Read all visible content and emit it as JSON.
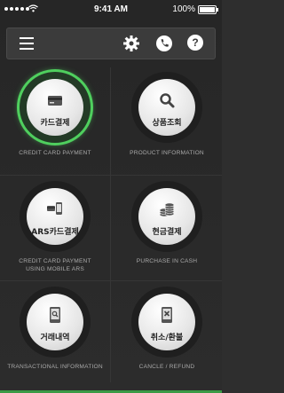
{
  "status_bar": {
    "time": "9:41 AM",
    "battery": "100%"
  },
  "toolbar": {
    "menu_icon": "hamburger-icon",
    "settings_icon": "gear-icon",
    "phone_icon": "phone-icon",
    "help_icon": "question-icon",
    "help_glyph": "?"
  },
  "colors": {
    "accent": "#4fcf5e",
    "background": "#2a2a2a",
    "caption": "#a9a9a9"
  },
  "tiles": [
    {
      "label": "카드결제",
      "caption_lines": [
        "CREDIT CARD PAYMENT"
      ],
      "icon": "credit-card-icon",
      "active": true
    },
    {
      "label": "상품조회",
      "caption_lines": [
        "PRODUCT INFORMATION"
      ],
      "icon": "search-icon",
      "active": false
    },
    {
      "label": "ARS카드결제",
      "caption_lines": [
        "CREDIT CARD PAYMENT",
        "USING MOBILE ARS"
      ],
      "icon": "mobile-ars-icon",
      "active": false
    },
    {
      "label": "현금결제",
      "caption_lines": [
        "PURCHASE IN CASH"
      ],
      "icon": "coins-icon",
      "active": false
    },
    {
      "label": "거래내역",
      "caption_lines": [
        "TRANSACTIONAL INFORMATION"
      ],
      "icon": "mobile-search-icon",
      "active": false
    },
    {
      "label": "취소/환불",
      "caption_lines": [
        "CANCLE / REFUND"
      ],
      "icon": "cancel-phone-icon",
      "active": false
    }
  ]
}
